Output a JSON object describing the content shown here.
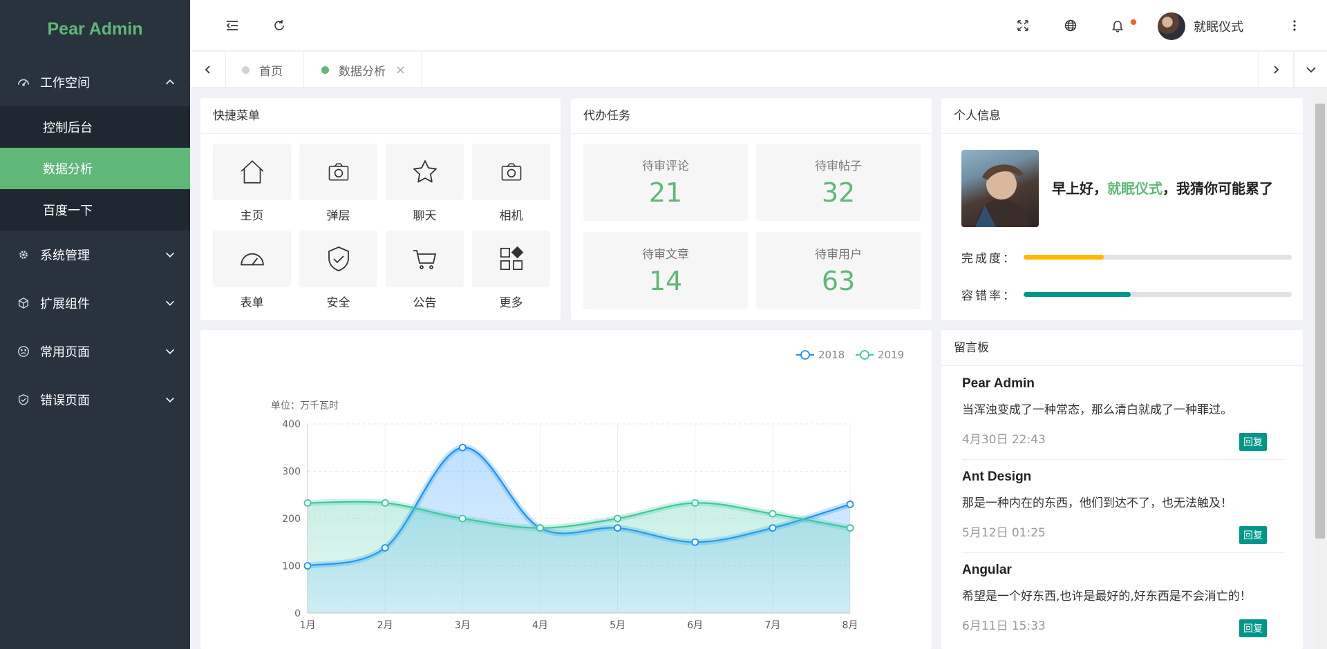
{
  "app": {
    "logo": "Pear Admin"
  },
  "sidebar": {
    "groups": [
      {
        "label": "工作空间",
        "icon": "dashboard-icon",
        "expanded": true,
        "items": [
          {
            "label": "控制后台"
          },
          {
            "label": "数据分析",
            "active": true
          },
          {
            "label": "百度一下"
          }
        ]
      },
      {
        "label": "系统管理",
        "icon": "gear-icon"
      },
      {
        "label": "扩展组件",
        "icon": "cube-icon"
      },
      {
        "label": "常用页面",
        "icon": "smile-icon"
      },
      {
        "label": "错误页面",
        "icon": "shield-check-icon"
      }
    ]
  },
  "header": {
    "user_name": "就眠仪式"
  },
  "tabs": [
    {
      "label": "首页"
    },
    {
      "label": "数据分析",
      "active": true
    }
  ],
  "quick_menu": {
    "title": "快捷菜单",
    "items": [
      {
        "label": "主页",
        "icon": "home-icon"
      },
      {
        "label": "弹层",
        "icon": "camera-icon"
      },
      {
        "label": "聊天",
        "icon": "star-icon"
      },
      {
        "label": "相机",
        "icon": "camera-icon"
      },
      {
        "label": "表单",
        "icon": "gauge-icon"
      },
      {
        "label": "安全",
        "icon": "shield-check-icon"
      },
      {
        "label": "公告",
        "icon": "cart-icon"
      },
      {
        "label": "更多",
        "icon": "apps-icon"
      }
    ]
  },
  "tasks": {
    "title": "代办任务",
    "items": [
      {
        "label": "待审评论",
        "value": "21"
      },
      {
        "label": "待审帖子",
        "value": "32"
      },
      {
        "label": "待审文章",
        "value": "14"
      },
      {
        "label": "待审用户",
        "value": "63"
      }
    ]
  },
  "profile": {
    "title": "个人信息",
    "greeting_prefix": "早上好，",
    "name": "就眠仪式",
    "greeting_suffix": "，我猜你可能累了",
    "completion_label": "完成度：",
    "completion": 0.3,
    "completion_color": "#ffb800",
    "error_label": "容错率：",
    "error_rate": 0.4,
    "error_color": "#009688"
  },
  "messages": {
    "title": "留言板",
    "reply_label": "回复",
    "items": [
      {
        "title": "Pear Admin",
        "content": "当浑浊变成了一种常态，那么清白就成了一种罪过。",
        "date": "4月30日 22:43"
      },
      {
        "title": "Ant Design",
        "content": "那是一种内在的东西，他们到达不了，也无法触及！",
        "date": "5月12日 01:25"
      },
      {
        "title": "Angular",
        "content": "希望是一个好东西,也许是最好的,好东西是不会消亡的！",
        "date": "6月11日 15:33"
      }
    ]
  },
  "chart_data": {
    "type": "line",
    "unit_label": "单位：万千瓦时",
    "categories": [
      "1月",
      "2月",
      "3月",
      "4月",
      "5月",
      "6月",
      "7月",
      "8月"
    ],
    "series": [
      {
        "name": "2018",
        "values": [
          100,
          138,
          350,
          180,
          180,
          150,
          180,
          230
        ],
        "color": "#1890ff"
      },
      {
        "name": "2019",
        "values": [
          233,
          233,
          200,
          180,
          200,
          233,
          210,
          180
        ],
        "color": "#3cc8a0"
      }
    ],
    "ylim": [
      0,
      400
    ],
    "yticks": [
      0,
      100,
      200,
      300,
      400
    ],
    "smooth": true,
    "area": true,
    "legend_position": "top-right",
    "grid": true
  }
}
